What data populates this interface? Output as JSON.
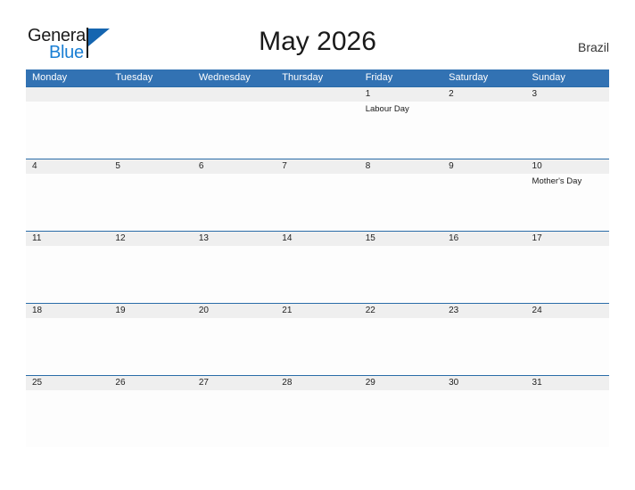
{
  "brand": {
    "name_part1": "General",
    "name_part2": "Blue",
    "flag_icon": "blue-triangle-flag-icon",
    "primary_color": "#1565b0",
    "accent_color": "#1a7fd4"
  },
  "header": {
    "title": "May 2026",
    "country": "Brazil"
  },
  "calendar": {
    "header_color": "#3272b3",
    "band_color": "#efefef",
    "row_rule_color": "#2a6ca8",
    "weekdays": [
      "Monday",
      "Tuesday",
      "Wednesday",
      "Thursday",
      "Friday",
      "Saturday",
      "Sunday"
    ],
    "weeks": [
      {
        "dates": [
          "",
          "",
          "",
          "",
          "1",
          "2",
          "3"
        ],
        "events": [
          "",
          "",
          "",
          "",
          "Labour Day",
          "",
          ""
        ]
      },
      {
        "dates": [
          "4",
          "5",
          "6",
          "7",
          "8",
          "9",
          "10"
        ],
        "events": [
          "",
          "",
          "",
          "",
          "",
          "",
          "Mother's Day"
        ]
      },
      {
        "dates": [
          "11",
          "12",
          "13",
          "14",
          "15",
          "16",
          "17"
        ],
        "events": [
          "",
          "",
          "",
          "",
          "",
          "",
          ""
        ]
      },
      {
        "dates": [
          "18",
          "19",
          "20",
          "21",
          "22",
          "23",
          "24"
        ],
        "events": [
          "",
          "",
          "",
          "",
          "",
          "",
          ""
        ]
      },
      {
        "dates": [
          "25",
          "26",
          "27",
          "28",
          "29",
          "30",
          "31"
        ],
        "events": [
          "",
          "",
          "",
          "",
          "",
          "",
          ""
        ]
      }
    ]
  }
}
